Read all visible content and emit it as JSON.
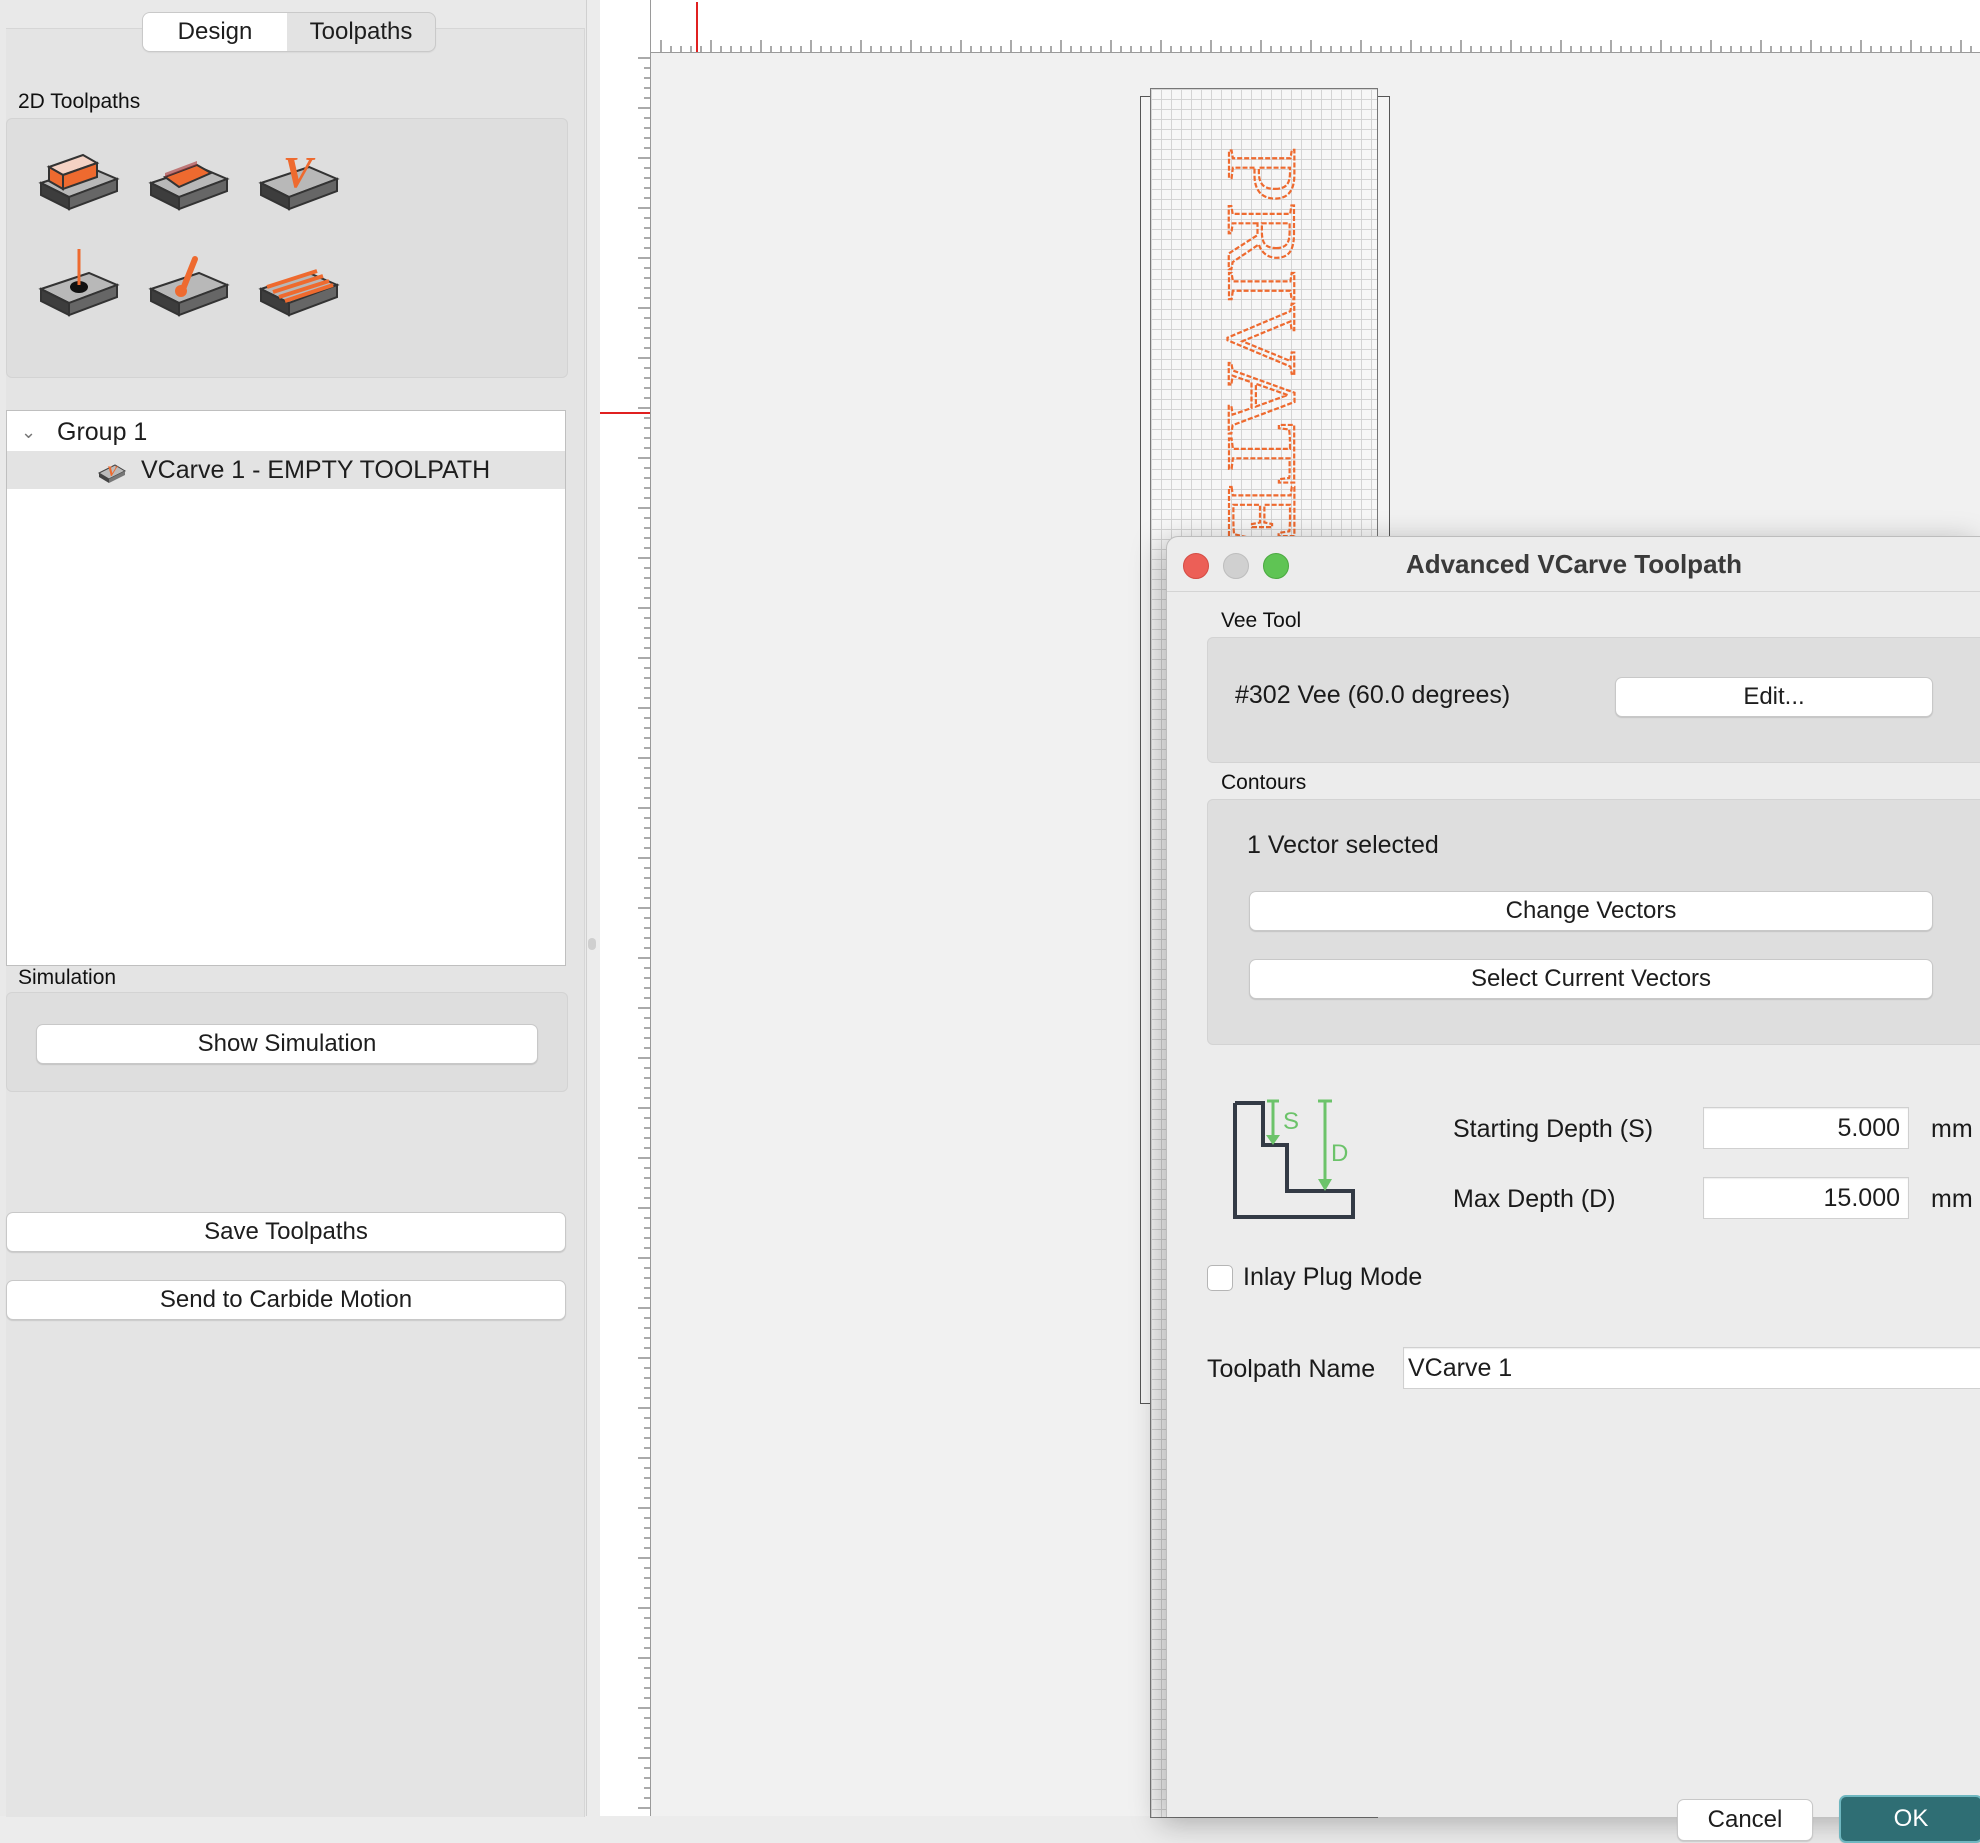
{
  "tabs": {
    "design": "Design",
    "toolpaths": "Toolpaths"
  },
  "toolpaths_2d": {
    "label": "2D Toolpaths",
    "buttons": [
      "contour-toolpath-icon",
      "pocket-toolpath-icon",
      "vcarve-toolpath-icon",
      "drill-toolpath-icon",
      "engrave-toolpath-icon",
      "texture-toolpath-icon"
    ]
  },
  "tree": {
    "group": "Group 1",
    "item": "VCarve 1 - EMPTY TOOLPATH"
  },
  "simulation": {
    "label": "Simulation",
    "show_button": "Show Simulation"
  },
  "actions": {
    "save": "Save Toolpaths",
    "send": "Send to Carbide Motion"
  },
  "design_text": "PRIVATE",
  "colors": {
    "accent_orange": "#ee6a2f",
    "ruler_red": "#e02020",
    "depth_green": "#6cc36a",
    "ok_teal": "#2f6e74"
  },
  "dialog": {
    "title": "Advanced VCarve Toolpath",
    "vee_tool": {
      "label": "Vee Tool",
      "tool_name": "#302 Vee (60.0 degrees)",
      "edit_button": "Edit..."
    },
    "contours": {
      "label": "Contours",
      "status": "1 Vector selected",
      "change_button": "Change Vectors",
      "select_button": "Select Current Vectors"
    },
    "depth": {
      "diagram_s": "S",
      "diagram_d": "D",
      "starting_label": "Starting Depth (S)",
      "starting_value": "5.000",
      "max_label": "Max Depth (D)",
      "max_value": "15.000",
      "unit": "mm"
    },
    "inlay": {
      "label": "Inlay Plug Mode",
      "checked": false
    },
    "name": {
      "label": "Toolpath Name",
      "value": "VCarve 1"
    },
    "buttons": {
      "cancel": "Cancel",
      "ok": "OK"
    }
  }
}
